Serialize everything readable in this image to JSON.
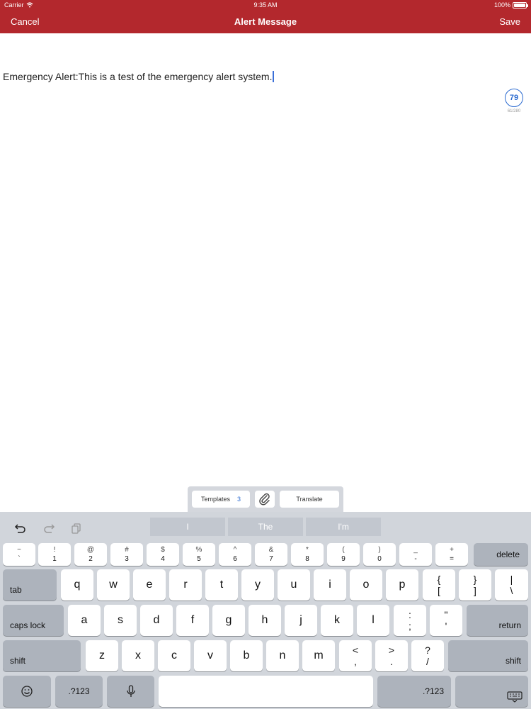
{
  "status_bar": {
    "carrier": "Carrier",
    "time": "9:35 AM",
    "battery": "100%"
  },
  "nav": {
    "cancel": "Cancel",
    "title": "Alert Message",
    "save": "Save"
  },
  "message": {
    "text": "Emergency Alert:This is a test of the emergency alert system."
  },
  "counter": {
    "value": "79",
    "sub": "61/280"
  },
  "accessory": {
    "templates_label": "Templates",
    "templates_count": "3",
    "attach_icon": "paperclip-icon",
    "translate_label": "Translate"
  },
  "keyboard": {
    "shortcuts": [
      "undo-icon",
      "redo-icon",
      "paste-icon"
    ],
    "suggestions": [
      "I",
      "The",
      "I'm"
    ],
    "number_row": [
      {
        "top": "~",
        "bottom": "`"
      },
      {
        "top": "!",
        "bottom": "1"
      },
      {
        "top": "@",
        "bottom": "2"
      },
      {
        "top": "#",
        "bottom": "3"
      },
      {
        "top": "$",
        "bottom": "4"
      },
      {
        "top": "%",
        "bottom": "5"
      },
      {
        "top": "^",
        "bottom": "6"
      },
      {
        "top": "&",
        "bottom": "7"
      },
      {
        "top": "*",
        "bottom": "8"
      },
      {
        "top": "(",
        "bottom": "9"
      },
      {
        "top": ")",
        "bottom": "0"
      },
      {
        "top": "_",
        "bottom": "-"
      },
      {
        "top": "+",
        "bottom": "="
      }
    ],
    "delete": "delete",
    "tab": "tab",
    "row_q": [
      "q",
      "w",
      "e",
      "r",
      "t",
      "y",
      "u",
      "i",
      "o",
      "p"
    ],
    "row_q_symbols": [
      {
        "top": "{",
        "bottom": "["
      },
      {
        "top": "}",
        "bottom": "]"
      },
      {
        "top": "|",
        "bottom": "\\"
      }
    ],
    "caps_lock": "caps lock",
    "row_a": [
      "a",
      "s",
      "d",
      "f",
      "g",
      "h",
      "j",
      "k",
      "l"
    ],
    "row_a_symbols": [
      {
        "top": ":",
        "bottom": ";"
      },
      {
        "top": "\"",
        "bottom": "'"
      }
    ],
    "return": "return",
    "shift": "shift",
    "row_z": [
      "z",
      "x",
      "c",
      "v",
      "b",
      "n",
      "m"
    ],
    "row_z_symbols": [
      {
        "top": "<",
        "bottom": ","
      },
      {
        "top": ">",
        "bottom": "."
      },
      {
        "top": "?",
        "bottom": "/"
      }
    ],
    "numbers_label": ".?123",
    "emoji_icon": "emoji-icon",
    "mic_icon": "microphone-icon",
    "hide_icon": "keyboard-hide-icon"
  }
}
